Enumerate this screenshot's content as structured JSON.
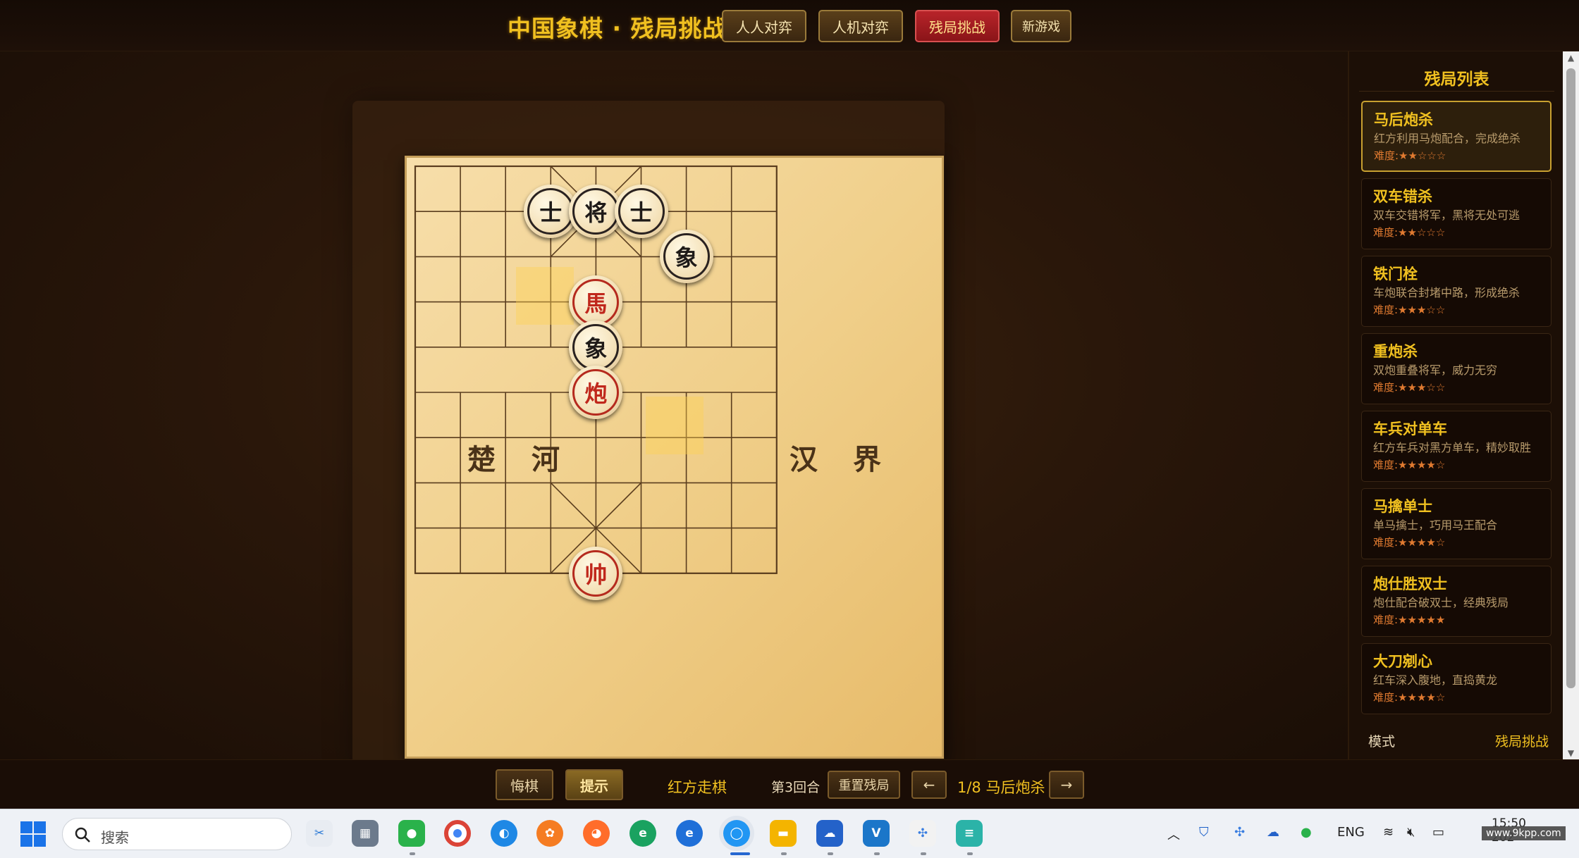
{
  "app": {
    "title": "中国象棋 · 残局挑战"
  },
  "modes": [
    {
      "label": "人人对弈"
    },
    {
      "label": "人机对弈"
    },
    {
      "label": "残局挑战",
      "active": true
    },
    {
      "label": "新游戏"
    }
  ],
  "board": {
    "river_left": [
      "楚",
      "河"
    ],
    "river_right": [
      "汉",
      "界"
    ],
    "pieces": [
      {
        "char": "士",
        "side": "black",
        "col": 3,
        "row": 1
      },
      {
        "char": "将",
        "side": "black",
        "col": 4,
        "row": 1
      },
      {
        "char": "士",
        "side": "black",
        "col": 5,
        "row": 1
      },
      {
        "char": "象",
        "side": "black",
        "col": 6,
        "row": 2
      },
      {
        "char": "馬",
        "side": "red",
        "col": 4,
        "row": 3
      },
      {
        "char": "象",
        "side": "black",
        "col": 4,
        "row": 4
      },
      {
        "char": "炮",
        "side": "red",
        "col": 4,
        "row": 5
      },
      {
        "char": "帅",
        "side": "red",
        "col": 4,
        "row": 9
      }
    ],
    "last_move": {
      "from": {
        "col": 2,
        "row": 2
      },
      "to": {
        "col": 4,
        "row": 4
      }
    }
  },
  "panel": {
    "title": "残局列表",
    "puzzles": [
      {
        "name": "马后炮杀",
        "desc": "红方利用马炮配合，完成绝杀",
        "difficulty": "难度:★★☆☆☆",
        "active": true
      },
      {
        "name": "双车错杀",
        "desc": "双车交错将军，黑将无处可逃",
        "difficulty": "难度:★★☆☆☆"
      },
      {
        "name": "铁门栓",
        "desc": "车炮联合封堵中路，形成绝杀",
        "difficulty": "难度:★★★☆☆"
      },
      {
        "name": "重炮杀",
        "desc": "双炮重叠将军，威力无穷",
        "difficulty": "难度:★★★☆☆"
      },
      {
        "name": "车兵对单车",
        "desc": "红方车兵对黑方单车，精妙取胜",
        "difficulty": "难度:★★★★☆"
      },
      {
        "name": "马擒单士",
        "desc": "单马擒士，巧用马王配合",
        "difficulty": "难度:★★★★☆"
      },
      {
        "name": "炮仕胜双士",
        "desc": "炮仕配合破双士，经典残局",
        "difficulty": "难度:★★★★★"
      },
      {
        "name": "大刀剜心",
        "desc": "红车深入腹地，直捣黄龙",
        "difficulty": "难度:★★★★☆"
      }
    ],
    "mode_label": "模式",
    "mode_value": "残局挑战"
  },
  "controls": {
    "undo": "悔棋",
    "hint": "提示",
    "turn": "红方走棋",
    "round": "第3回合",
    "reset": "重置残局",
    "prev": "←",
    "puzzle_index": "1/8 马后炮杀",
    "next": "→"
  },
  "taskbar": {
    "search_placeholder": "搜索",
    "apps": [
      "snipping-tool",
      "calculator",
      "wechat",
      "chrome",
      "browser",
      "paw-app",
      "firefox",
      "edge",
      "ie",
      "qq-browser",
      "file-explorer",
      "onedrive",
      "vscode",
      "network-app",
      "notepad"
    ],
    "lang": "ENG",
    "time": "15:50",
    "date": "202",
    "watermark": "www.9kpp.com"
  },
  "colors": {
    "accent_gold": "#f0c020",
    "active_red": "#b8242a",
    "red_piece": "#c0281c",
    "black_piece": "#1e1a18",
    "board_wood": "#f0cf8a"
  }
}
